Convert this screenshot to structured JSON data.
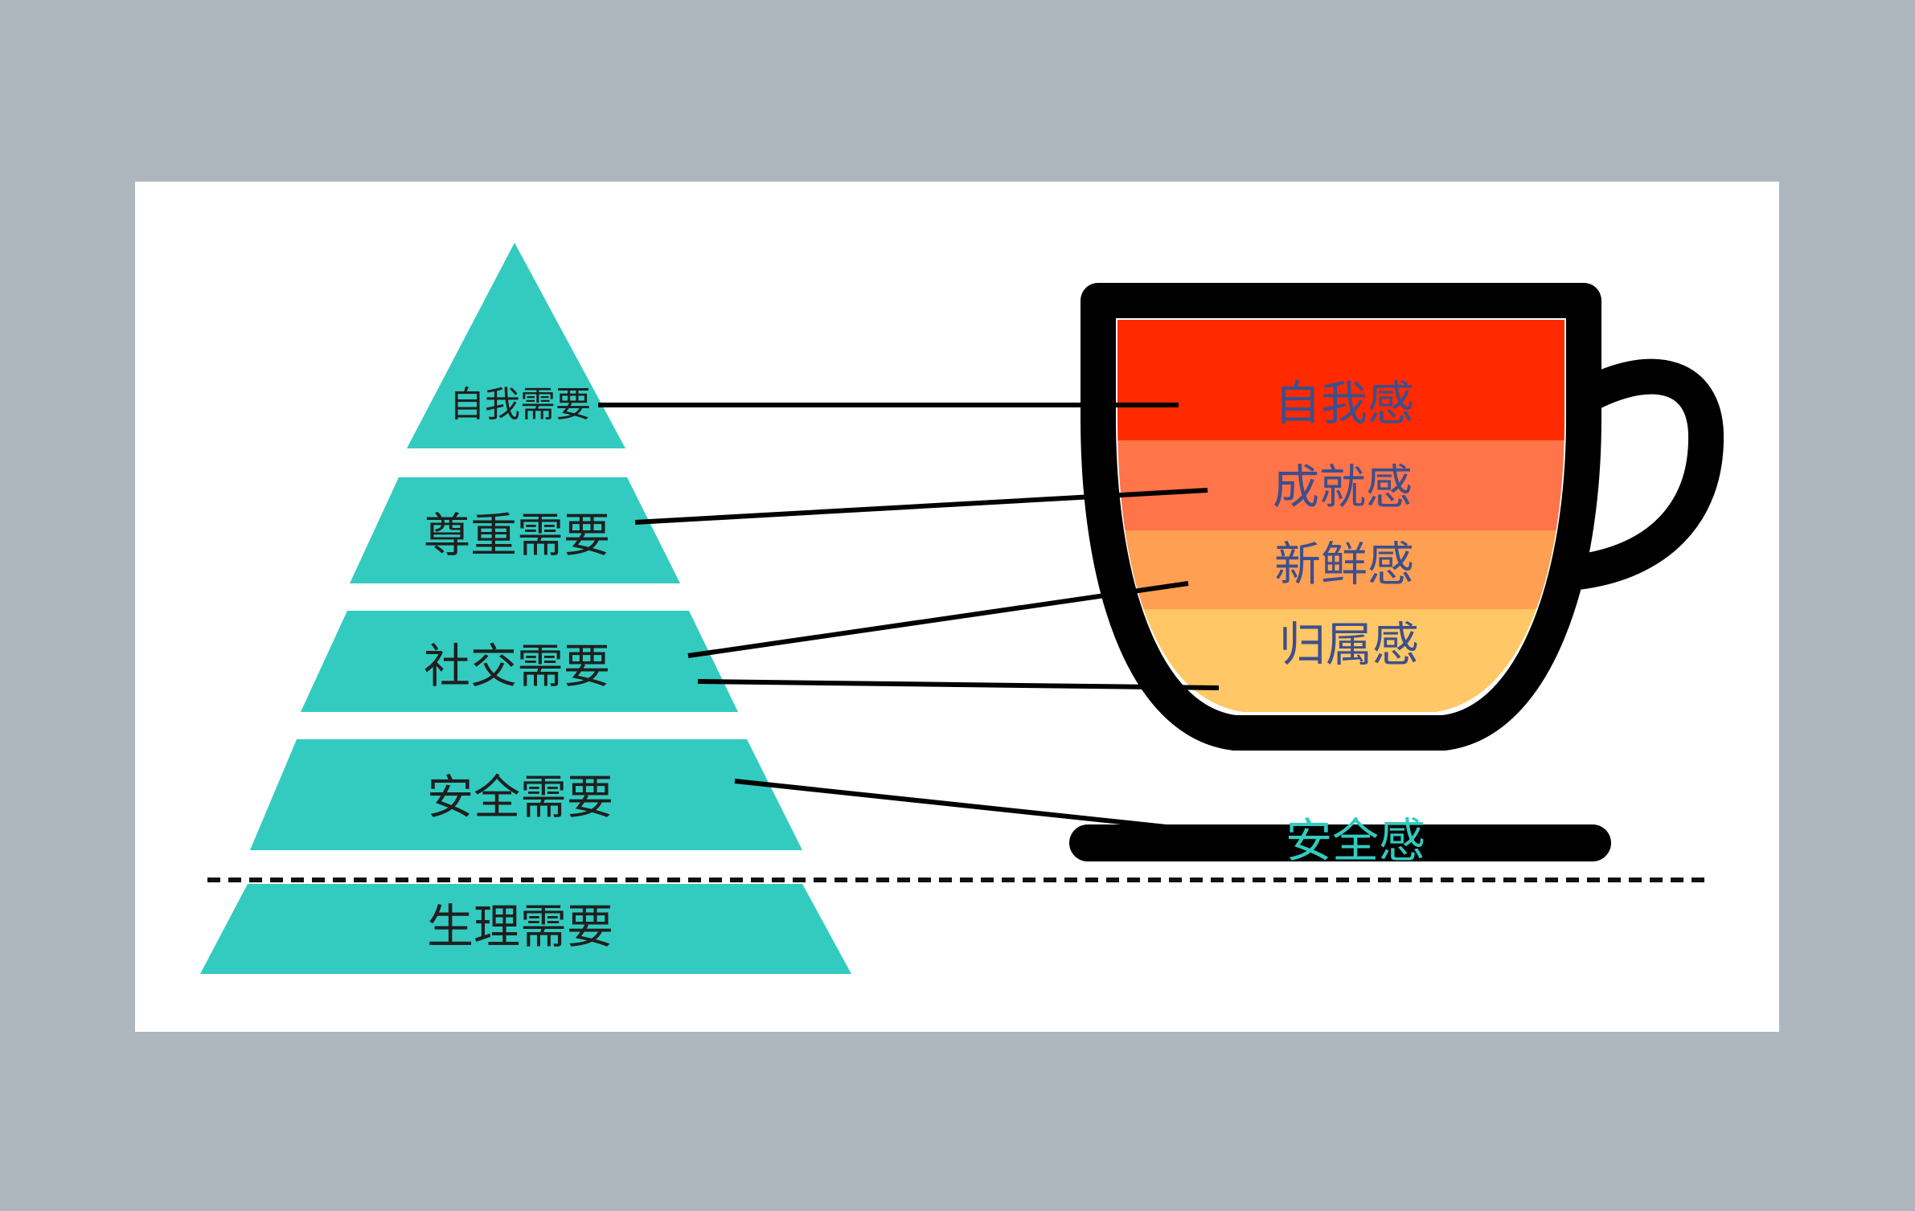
{
  "diagram": {
    "pyramid": {
      "color": "#33cbbf",
      "levels": [
        {
          "label": "自我需要"
        },
        {
          "label": "尊重需要"
        },
        {
          "label": "社交需要"
        },
        {
          "label": "安全需要"
        },
        {
          "label": "生理需要"
        }
      ]
    },
    "cup": {
      "outline_color": "#000000",
      "layers": [
        {
          "label": "自我感",
          "color": "#ff2a00"
        },
        {
          "label": "成就感",
          "color": "#ff7448"
        },
        {
          "label": "新鲜感",
          "color": "#ff9f52"
        },
        {
          "label": "归属感",
          "color": "#ffc766"
        }
      ],
      "saucer_label": "安全感"
    }
  }
}
